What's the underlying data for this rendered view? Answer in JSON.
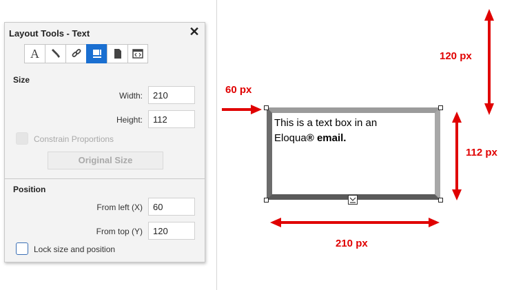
{
  "panel": {
    "title": "Layout Tools - Text",
    "close_icon": "close-icon",
    "tabs": [
      {
        "icon": "font-icon",
        "active": false
      },
      {
        "icon": "paint-brush-icon",
        "active": false
      },
      {
        "icon": "link-icon",
        "active": false
      },
      {
        "icon": "layout-size-icon",
        "active": true
      },
      {
        "icon": "file-icon",
        "active": false
      },
      {
        "icon": "code-icon",
        "active": false
      }
    ],
    "size": {
      "heading": "Size",
      "width_label": "Width:",
      "width_value": "210",
      "height_label": "Height:",
      "height_value": "112",
      "constrain_label": "Constrain Proportions",
      "original_size_label": "Original Size"
    },
    "position": {
      "heading": "Position",
      "from_left_label": "From left (X)",
      "from_left_value": "60",
      "from_top_label": "From top (Y)",
      "from_top_value": "120",
      "lock_label": "Lock size and position"
    }
  },
  "canvas": {
    "top_offset_label": "120 px",
    "left_offset_label": "60 px",
    "height_label": "112 px",
    "width_label": "210 px",
    "textbox_line1": "This is a text box in an",
    "textbox_line2_prefix": "Eloqua",
    "textbox_registered": "®",
    "textbox_bold": "email."
  },
  "colors": {
    "accent": "#1a6fd1",
    "arrow": "#e00000"
  }
}
